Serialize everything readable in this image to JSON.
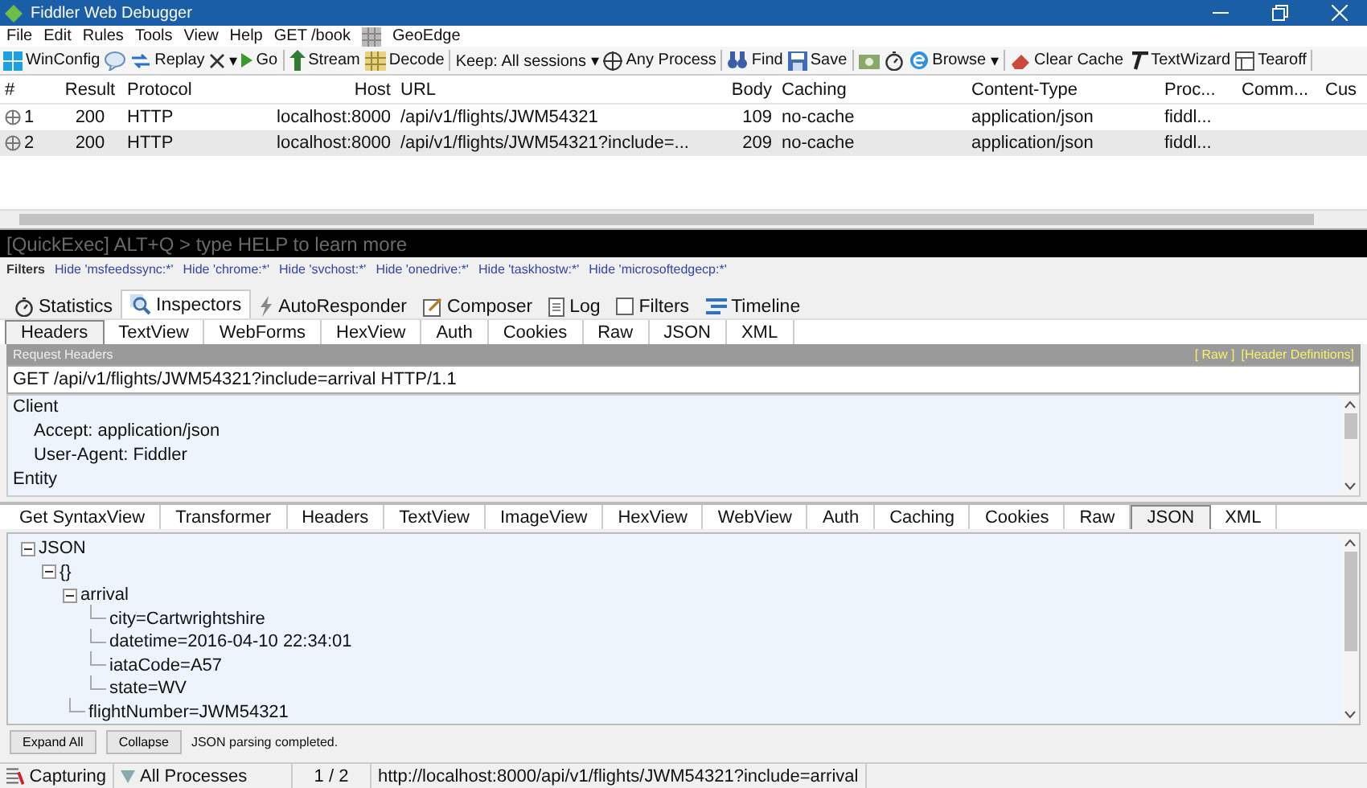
{
  "window": {
    "title": "Fiddler Web Debugger"
  },
  "menu": [
    "File",
    "Edit",
    "Rules",
    "Tools",
    "View",
    "Help",
    "GET /book",
    "GeoEdge"
  ],
  "toolbar": [
    {
      "label": "WinConfig"
    },
    {
      "kind": "icon"
    },
    {
      "label": "Replay"
    },
    {
      "label": "▾"
    },
    {
      "label": "Go"
    },
    {
      "label": "Stream"
    },
    {
      "label": "Decode"
    },
    {
      "label": "Keep: All sessions ▾"
    },
    {
      "label": "Any Process"
    },
    {
      "label": "Find"
    },
    {
      "label": "Save"
    },
    {
      "kind": "icon"
    },
    {
      "kind": "icon"
    },
    {
      "label": "Browse"
    },
    {
      "label": "▾"
    },
    {
      "label": "Clear Cache"
    },
    {
      "label": "TextWizard"
    },
    {
      "label": "Tearoff"
    }
  ],
  "sessions": {
    "columns": [
      "#",
      "Result",
      "Protocol",
      "Host",
      "URL",
      "Body",
      "Caching",
      "Content-Type",
      "Proc...",
      "Comm...",
      "Cus"
    ],
    "rows": [
      {
        "num": "1",
        "result": "200",
        "protocol": "HTTP",
        "host": "localhost:8000",
        "url": "/api/v1/flights/JWM54321",
        "body": "109",
        "caching": "no-cache",
        "content_type": "application/json",
        "process": "fiddl...",
        "selected": false
      },
      {
        "num": "2",
        "result": "200",
        "protocol": "HTTP",
        "host": "localhost:8000",
        "url": "/api/v1/flights/JWM54321?include=...",
        "body": "209",
        "caching": "no-cache",
        "content_type": "application/json",
        "process": "fiddl...",
        "selected": true
      }
    ]
  },
  "quickexec": {
    "placeholder": "[QuickExec] ALT+Q > type HELP to learn more"
  },
  "filters": {
    "label": "Filters",
    "items": [
      "Hide 'msfeedssync:*'",
      "Hide 'chrome:*'",
      "Hide 'svchost:*'",
      "Hide 'onedrive:*'",
      "Hide 'taskhostw:*'",
      "Hide 'microsoftedgecp:*'"
    ]
  },
  "tabs": [
    {
      "label": "Statistics",
      "selected": false
    },
    {
      "label": "Inspectors",
      "selected": true
    },
    {
      "label": "AutoResponder",
      "selected": false
    },
    {
      "label": "Composer",
      "selected": false
    },
    {
      "label": "Log",
      "selected": false
    },
    {
      "label": "Filters",
      "selected": false
    },
    {
      "label": "Timeline",
      "selected": false
    }
  ],
  "request_tabs": [
    {
      "label": "Headers",
      "selected": true
    },
    {
      "label": "TextView",
      "selected": false
    },
    {
      "label": "WebForms",
      "selected": false
    },
    {
      "label": "HexView",
      "selected": false
    },
    {
      "label": "Auth",
      "selected": false
    },
    {
      "label": "Cookies",
      "selected": false
    },
    {
      "label": "Raw",
      "selected": false
    },
    {
      "label": "JSON",
      "selected": false
    },
    {
      "label": "XML",
      "selected": false
    }
  ],
  "request_headers": {
    "title": "Request Headers",
    "links": [
      "[ Raw ]",
      "[Header Definitions]"
    ],
    "request_line": "GET /api/v1/flights/JWM54321?include=arrival HTTP/1.1",
    "groups": [
      {
        "label": "Client",
        "children": [
          {
            "label": "Accept: application/json"
          },
          {
            "label": "User-Agent: Fiddler"
          }
        ]
      },
      {
        "label": "Entity"
      }
    ]
  },
  "response_tabs": [
    {
      "label": "Get SyntaxView",
      "selected": false
    },
    {
      "label": "Transformer",
      "selected": false
    },
    {
      "label": "Headers",
      "selected": false
    },
    {
      "label": "TextView",
      "selected": false
    },
    {
      "label": "ImageView",
      "selected": false
    },
    {
      "label": "HexView",
      "selected": false
    },
    {
      "label": "WebView",
      "selected": false
    },
    {
      "label": "Auth",
      "selected": false
    },
    {
      "label": "Caching",
      "selected": false
    },
    {
      "label": "Cookies",
      "selected": false
    },
    {
      "label": "Raw",
      "selected": false
    },
    {
      "label": "JSON",
      "selected": true
    },
    {
      "label": "XML",
      "selected": false
    }
  ],
  "json_tree": [
    {
      "label": "JSON",
      "expanded": true,
      "children": [
        {
          "label": "{}",
          "expanded": true,
          "children": [
            {
              "label": "arrival",
              "expanded": true,
              "children": [
                {
                  "label": "city=Cartwrightshire"
                },
                {
                  "label": "datetime=2016-04-10 22:34:01"
                },
                {
                  "label": "iataCode=A57"
                },
                {
                  "label": "state=WV"
                }
              ]
            },
            {
              "label": "flightNumber=JWM54321"
            }
          ]
        }
      ]
    }
  ],
  "json_buttons": [
    "Expand All",
    "Collapse"
  ],
  "json_status": "JSON parsing completed.",
  "status_bar": {
    "capture": "Capturing",
    "processes": "All Processes",
    "count": "1 / 2",
    "url": "http://localhost:8000/api/v1/flights/JWM54321?include=arrival"
  }
}
